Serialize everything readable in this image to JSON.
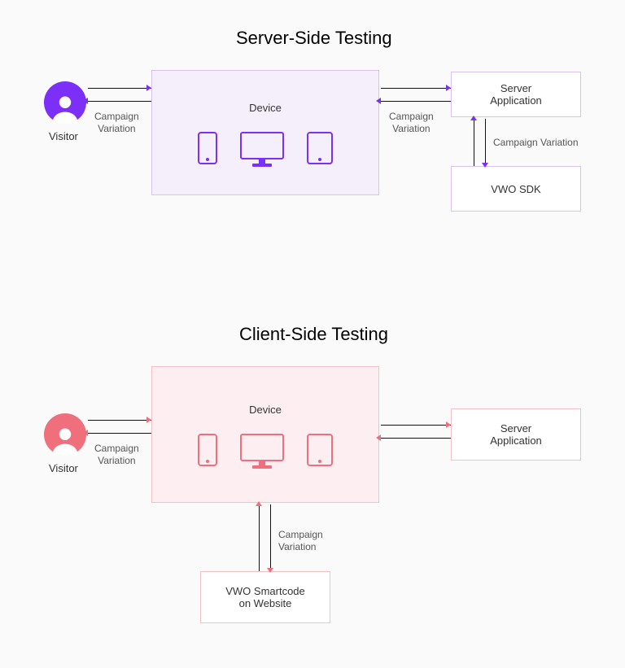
{
  "server": {
    "title": "Server-Side Testing",
    "visitor": "Visitor",
    "device_label": "Device",
    "server_app": "Server\nApplication",
    "sdk": "VWO SDK",
    "conn_vd": "Campaign\nVariation",
    "conn_ds": "Campaign\nVariation",
    "conn_sk": "Campaign Variation"
  },
  "client": {
    "title": "Client-Side Testing",
    "visitor": "Visitor",
    "device_label": "Device",
    "server_app": "Server\nApplication",
    "smartcode": "VWO Smartcode\non Website",
    "conn_vd": "Campaign\nVariation",
    "conn_dc": "Campaign\nVariation"
  }
}
